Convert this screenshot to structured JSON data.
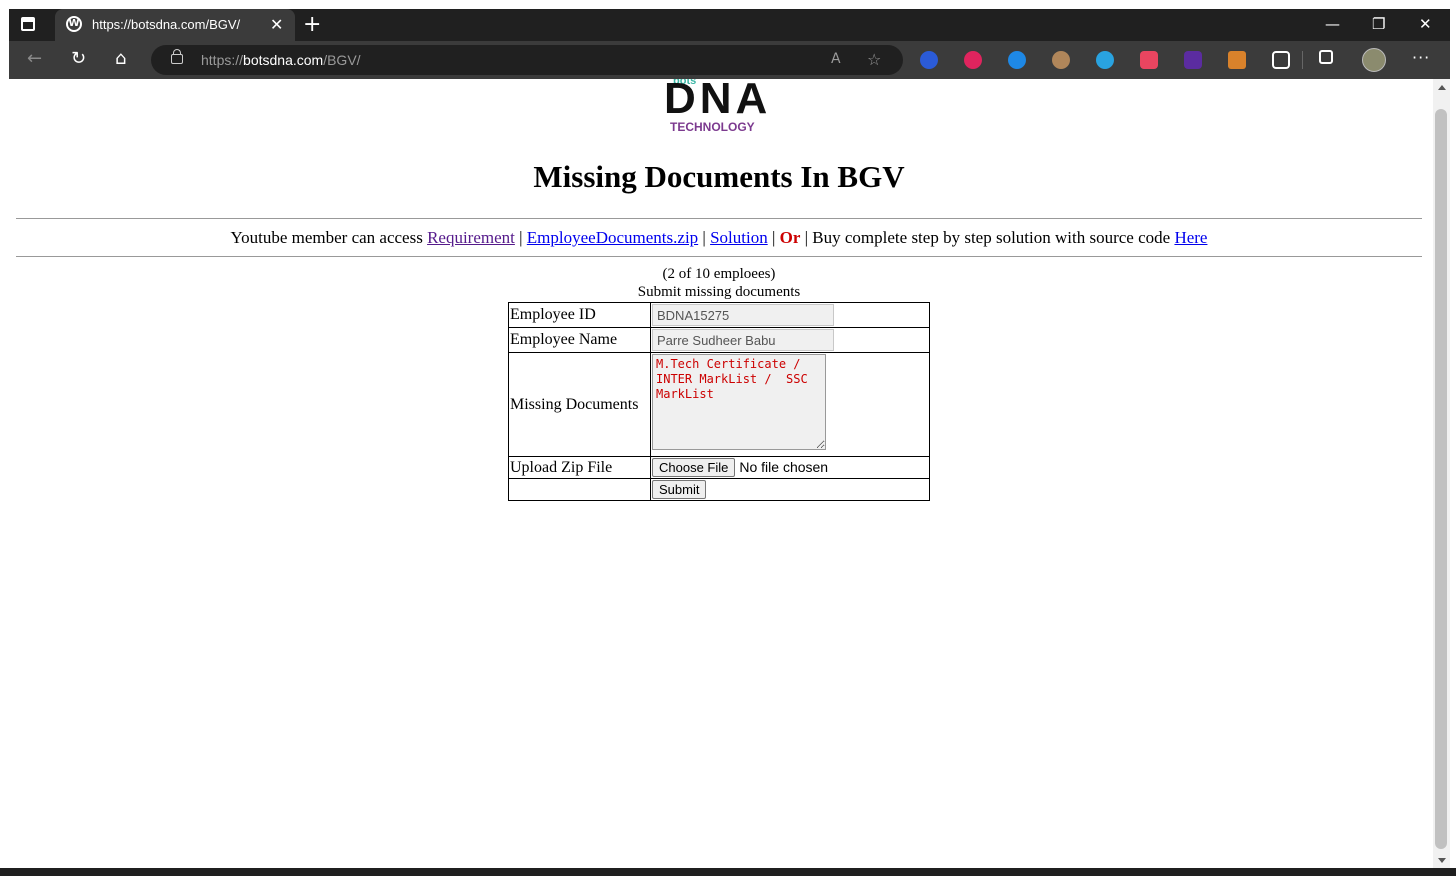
{
  "browser": {
    "tab_title": "https://botsdna.com/BGV/",
    "url_scheme": "https://",
    "url_host": "botsdna.com",
    "url_path": "/BGV/",
    "new_tab_label": "+",
    "icons": [
      "tab-actions-icon",
      "wordpress-favicon-icon",
      "close-icon",
      "plus-icon",
      "minimize-icon",
      "restore-icon",
      "window-close-icon",
      "back-icon",
      "reload-icon",
      "home-icon",
      "lock-icon",
      "read-aloud-icon",
      "favorite-star-icon",
      "extension-icons",
      "collections-icon",
      "profile-avatar",
      "more-icon"
    ]
  },
  "logo": {
    "top": "bots",
    "main": "DNA",
    "bottom": "TECHNOLOGY"
  },
  "page": {
    "title": "Missing Documents In BGV",
    "intro": "Youtube member can access",
    "link_requirement": "Requirement",
    "link_documents": "EmployeeDocuments.zip",
    "link_solution": "Solution",
    "or_text": "Or",
    "buy_text": "Buy complete step by step solution with source code",
    "link_here": "Here",
    "sep": "|",
    "count_text": "(2 of 10 emploees)",
    "submit_heading": "Submit missing documents"
  },
  "form": {
    "employee_id_label": "Employee ID",
    "employee_id_value": "BDNA15275",
    "employee_name_label": "Employee Name",
    "employee_name_value": "Parre Sudheer Babu",
    "missing_docs_label": "Missing Documents",
    "missing_docs_value": "M.Tech Certificate / INTER MarkList /  SSC MarkList",
    "upload_label": "Upload Zip File",
    "choose_file_label": "Choose File",
    "file_status": "No file chosen",
    "submit_label": "Submit"
  },
  "colors": {
    "tab_bar": "#202020",
    "toolbar": "#3b3b3b",
    "link": "#0000ee",
    "visited_link": "#551a8b",
    "or_red": "#cc0000",
    "logo_purple": "#7c3a8f",
    "logo_teal": "#3bb6a5"
  }
}
